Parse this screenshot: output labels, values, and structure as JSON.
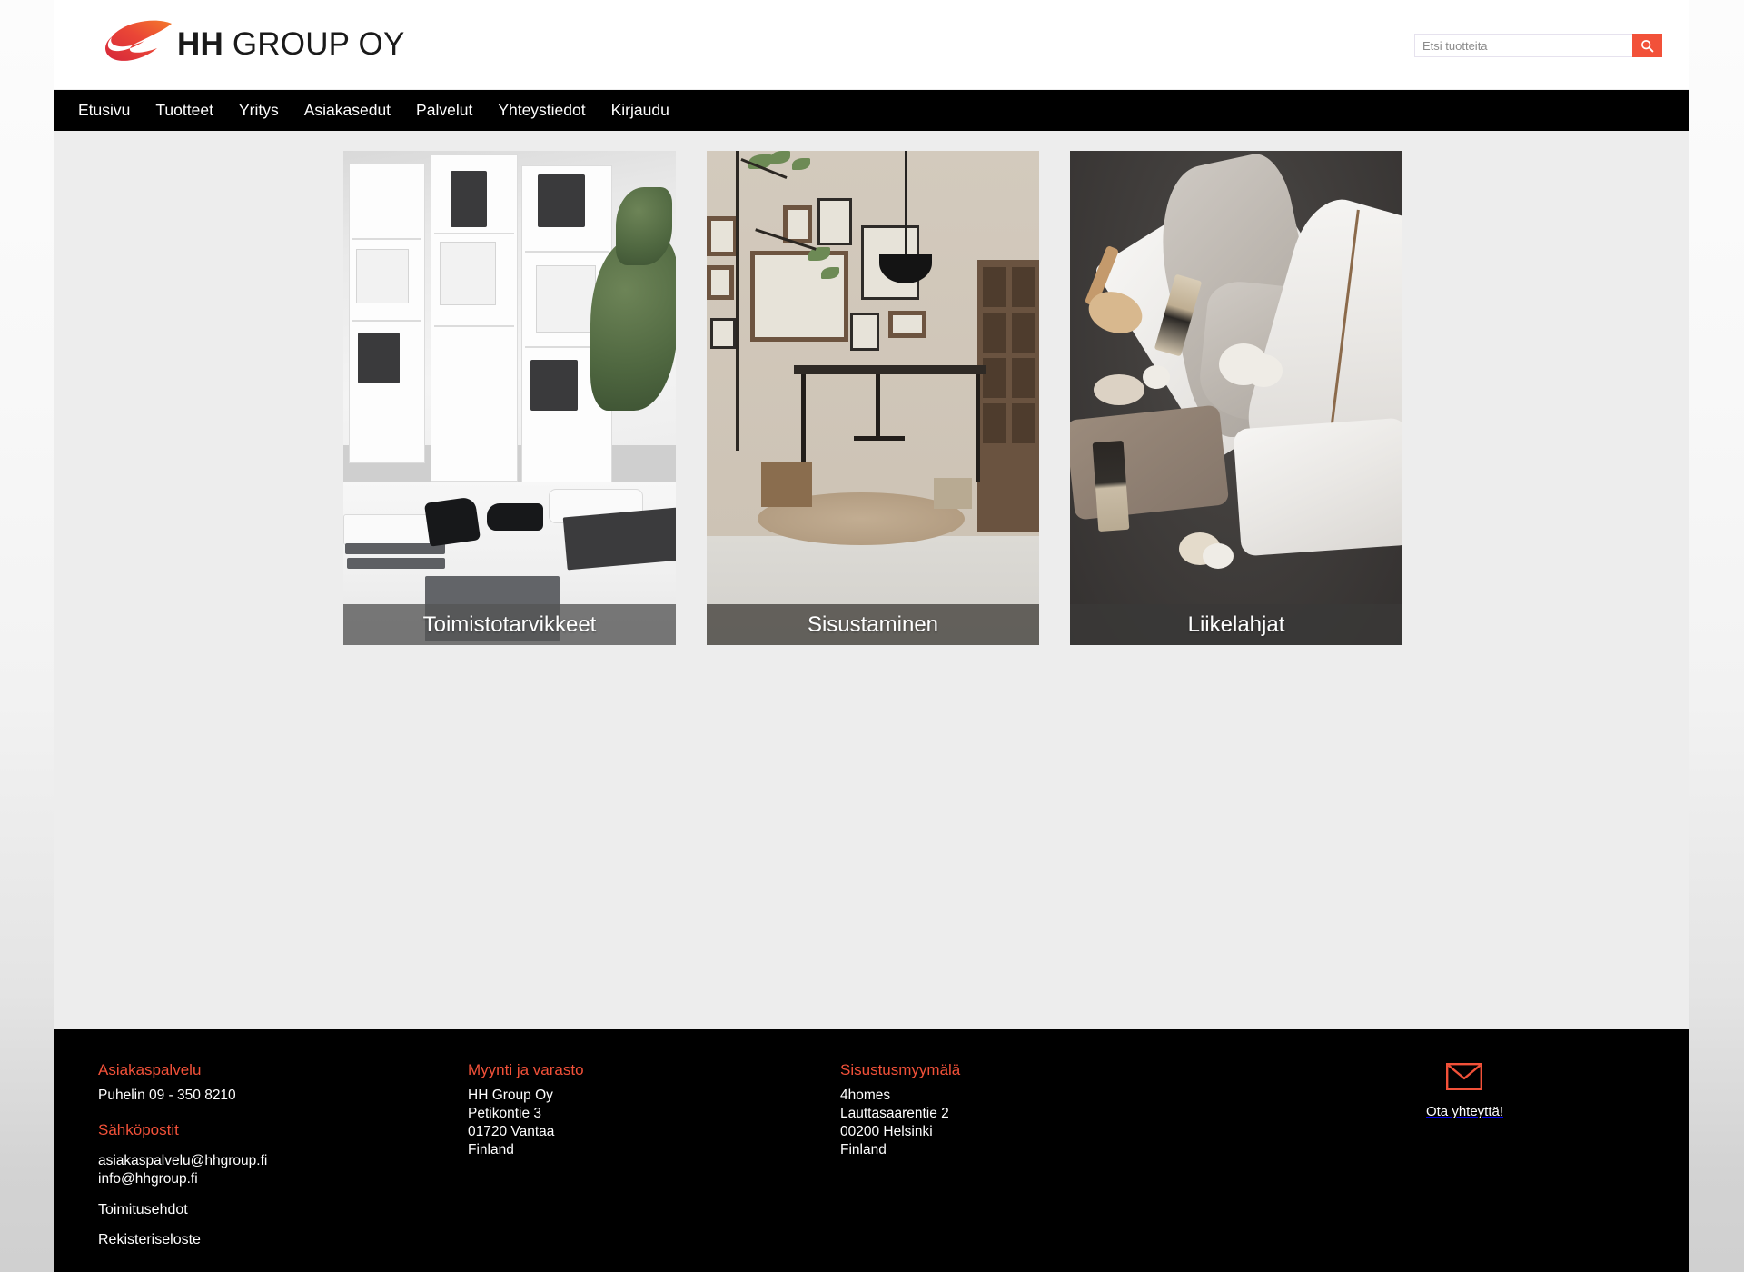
{
  "brand": {
    "logo_icon": "swoosh-logo-icon",
    "name_bold": "HH",
    "name_light": " GROUP OY",
    "accent_color": "#f25139"
  },
  "search": {
    "placeholder": "Etsi tuotteita",
    "value": "",
    "button_icon": "search-icon"
  },
  "nav": {
    "items": [
      {
        "label": "Etusivu"
      },
      {
        "label": "Tuotteet"
      },
      {
        "label": "Yritys"
      },
      {
        "label": "Asiakasedut"
      },
      {
        "label": "Palvelut"
      },
      {
        "label": "Yhteystiedot"
      },
      {
        "label": "Kirjaudu"
      }
    ]
  },
  "main": {
    "cards": [
      {
        "caption": "Toimistotarvikkeet",
        "image_alt": "office-supplies-photo"
      },
      {
        "caption": "Sisustaminen",
        "image_alt": "interior-decor-photo"
      },
      {
        "caption": "Liikelahjat",
        "image_alt": "spa-towels-photo"
      }
    ]
  },
  "footer": {
    "customer_service": {
      "heading": "Asiakaspalvelu",
      "phone": "Puhelin 09 - 350 8210",
      "email_heading": "Sähköpostit",
      "emails": [
        "asiakaspalvelu@hhgroup.fi",
        "info@hhgroup.fi"
      ],
      "links": [
        "Toimitusehdot",
        "Rekisteriseloste"
      ]
    },
    "sales": {
      "heading": "Myynti ja varasto",
      "lines": [
        "HH Group Oy",
        "Petikontie 3",
        "01720 Vantaa",
        "Finland"
      ]
    },
    "showroom": {
      "heading": "Sisustusmyymälä",
      "lines": [
        "4homes",
        "Lauttasaarentie 2",
        "00200 Helsinki",
        "Finland"
      ]
    },
    "contact": {
      "icon": "envelope-icon",
      "label": "Ota yhteyttä!"
    }
  }
}
